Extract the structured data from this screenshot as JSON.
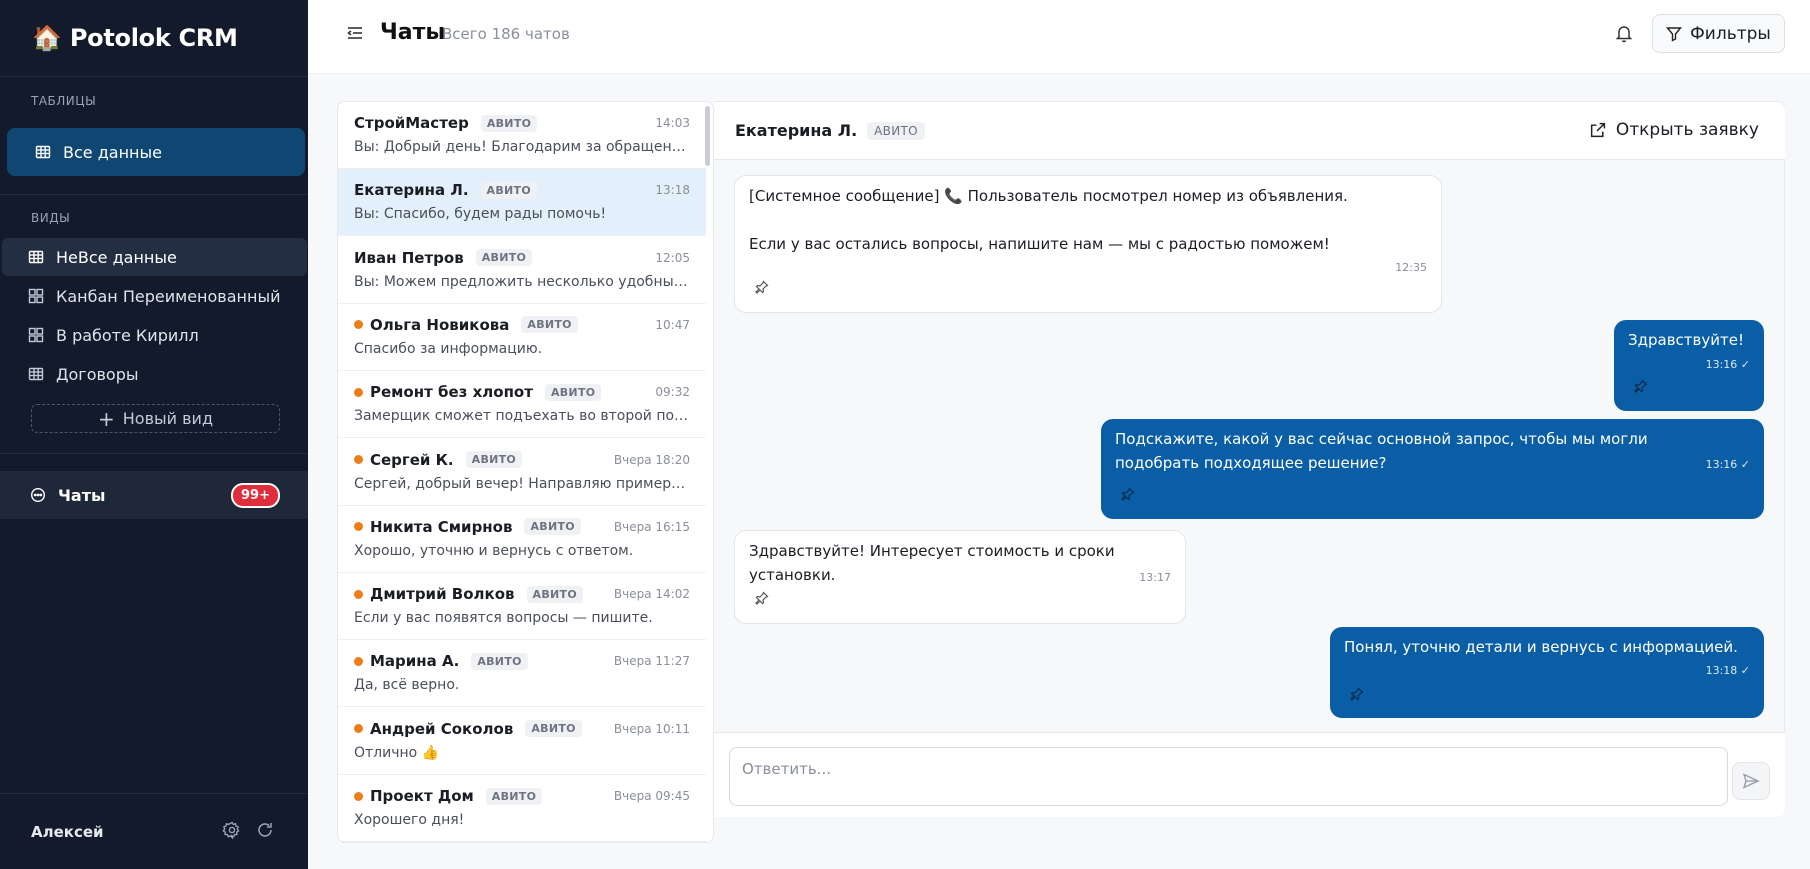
{
  "app": {
    "name": "Potolok CRM",
    "logo_emoji": "🏠"
  },
  "sidebar": {
    "tables_label": "ТАБЛИЦЫ",
    "all_data": "Все данные",
    "views_label": "ВИДЫ",
    "views": [
      {
        "label": "НеВсе данные",
        "icon": "table-icon"
      },
      {
        "label": "Канбан Переименованный",
        "icon": "kanban-icon"
      },
      {
        "label": "В работе Кирилл",
        "icon": "kanban-icon"
      },
      {
        "label": "Договоры",
        "icon": "table-icon"
      }
    ],
    "new_view": "Новый вид",
    "chats": {
      "label": "Чаты",
      "badge": "99+"
    },
    "user": "Алексей"
  },
  "header": {
    "title": "Чаты",
    "subtitle": "Всего 186 чатов",
    "filters_label": "Фильтры"
  },
  "chats": [
    {
      "name": "СтройМастер",
      "source": "АВИТО",
      "time": "14:03",
      "preview": "Вы: Добрый день! Благодарим за обращение. Мы...",
      "unread": false,
      "selected": false
    },
    {
      "name": "Екатерина Л.",
      "source": "АВИТО",
      "time": "13:18",
      "preview": "Вы: Спасибо, будем рады помочь!",
      "unread": false,
      "selected": true
    },
    {
      "name": "Иван Петров",
      "source": "АВИТО",
      "time": "12:05",
      "preview": "Вы: Можем предложить несколько удобных вариантов",
      "unread": false,
      "selected": false
    },
    {
      "name": "Ольга Новикова",
      "source": "АВИТО",
      "time": "10:47",
      "preview": "Спасибо за информацию.",
      "unread": true,
      "selected": false
    },
    {
      "name": "Ремонт без хлопот",
      "source": "АВИТО",
      "time": "09:32",
      "preview": "Замерщик сможет подъехать во второй половине дня",
      "unread": true,
      "selected": false
    },
    {
      "name": "Сергей К.",
      "source": "АВИТО",
      "time": "Вчера 18:20",
      "preview": "Сергей, добрый вечер! Направляю примеры работ",
      "unread": true,
      "selected": false
    },
    {
      "name": "Никита Смирнов",
      "source": "АВИТО",
      "time": "Вчера 16:15",
      "preview": "Хорошо, уточню и вернусь с ответом.",
      "unread": true,
      "selected": false
    },
    {
      "name": "Дмитрий Волков",
      "source": "АВИТО",
      "time": "Вчера 14:02",
      "preview": "Если у вас появятся вопросы — пишите.",
      "unread": true,
      "selected": false
    },
    {
      "name": "Марина А.",
      "source": "АВИТО",
      "time": "Вчера 11:27",
      "preview": "Да, всё верно.",
      "unread": true,
      "selected": false
    },
    {
      "name": "Андрей Соколов",
      "source": "АВИТО",
      "time": "Вчера 10:11",
      "preview": "Отлично 👍",
      "unread": true,
      "selected": false
    },
    {
      "name": "Проект Дом",
      "source": "АВИТО",
      "time": "Вчера 09:45",
      "preview": "Хорошего дня!",
      "unread": true,
      "selected": false
    }
  ],
  "conversation": {
    "name": "Екатерина Л.",
    "source": "АВИТО",
    "open_request": "Открыть заявку",
    "messages": [
      {
        "dir": "in",
        "text": "[Системное сообщение] 📞 Пользователь посмотрел номер из объявления.\n\nЕсли у вас остались вопросы, напишите нам — мы с радостью поможем!",
        "time": "12:35"
      },
      {
        "dir": "out",
        "text": "Здравствуйте!",
        "time": "13:16 ✓"
      },
      {
        "dir": "out",
        "text": "Подскажите, какой у вас сейчас основной запрос, чтобы мы могли подобрать подходящее решение?",
        "time": "13:16 ✓"
      },
      {
        "dir": "in",
        "text": "Здравствуйте! Интересует стоимость и сроки установки.",
        "time": "13:17"
      },
      {
        "dir": "out",
        "text": "Понял, уточню детали и вернусь с информацией.",
        "time": "13:18 ✓"
      }
    ],
    "reply_placeholder": "Ответить..."
  },
  "colors": {
    "sidebar_bg": "#121a2c",
    "accent": "#0a5ea6",
    "unread_dot": "#ef7d16",
    "badge": "#e02d3c"
  }
}
